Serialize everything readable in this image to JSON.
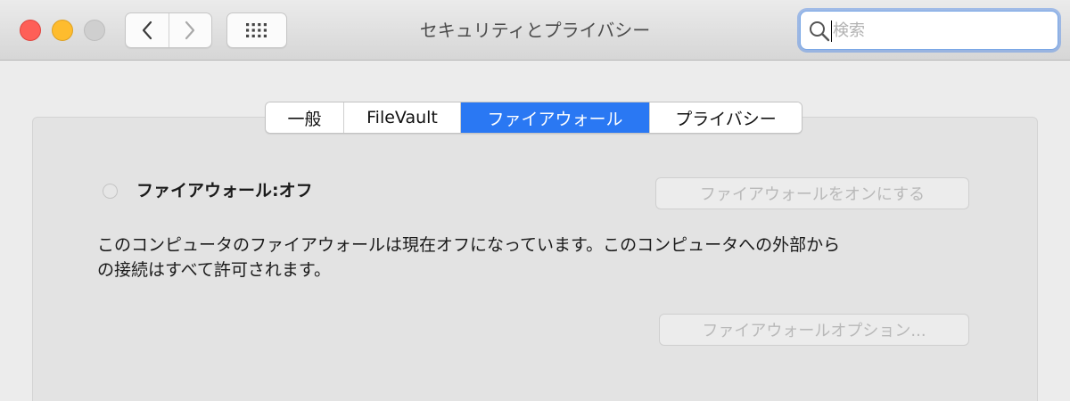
{
  "window": {
    "title": "セキュリティとプライバシー"
  },
  "toolbar": {
    "back_icon": "chevron-left-icon",
    "forward_icon": "chevron-right-icon",
    "show_all_icon": "grid-icon",
    "search": {
      "placeholder": "検索",
      "value": ""
    }
  },
  "tabs": [
    {
      "label": "一般",
      "active": false
    },
    {
      "label": "FileVault",
      "active": false
    },
    {
      "label": "ファイアウォール",
      "active": true
    },
    {
      "label": "プライバシー",
      "active": false
    }
  ],
  "firewall": {
    "status_label": "ファイアウォール:オフ",
    "turn_on_button": "ファイアウォールをオンにする",
    "description_line1": "このコンピュータのファイアウォールは現在オフになっています。このコンピュータへの外部から",
    "description_line2": "の接続はすべて許可されます。",
    "options_button": "ファイアウォールオプション..."
  },
  "colors": {
    "accent": "#2a78f3",
    "close": "#fe5f57",
    "minimize": "#febc2e",
    "zoom_inactive": "#cfcfcf"
  }
}
